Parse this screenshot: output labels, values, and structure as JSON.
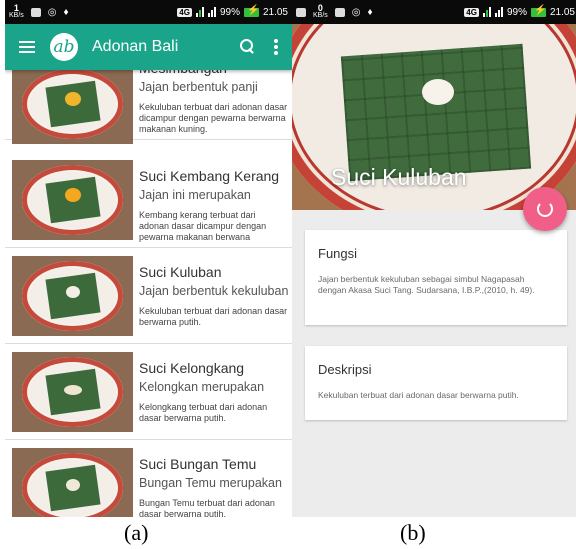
{
  "status_bar_a": {
    "kbs_value": "1",
    "kbs_unit": "KB/s",
    "network": "4G",
    "battery": "99%",
    "time": "21.05"
  },
  "status_bar_b": {
    "kbs_value": "0",
    "kbs_unit": "KB/s",
    "network": "4G",
    "battery": "99%",
    "time": "21.05"
  },
  "app_bar": {
    "title": "Adonan Bali",
    "logo_text": "ab",
    "icons": [
      "menu-icon",
      "search-icon",
      "more-vert-icon"
    ]
  },
  "list": {
    "items": [
      {
        "title": "Mesimbangan",
        "subtitle": "Jajan berbentuk panji",
        "description": "Kekuluban terbuat dari adonan dasar dicampur dengan pewarna berwarna makanan kuning.",
        "food_color": "#f1b52c"
      },
      {
        "title": "Suci Kembang Kerang",
        "subtitle": "Jajan ini merupakan",
        "description": "Kembang kerang terbuat dari adonan dasar dicampur dengan pewarna makanan berwana",
        "food_color": "#f3a820"
      },
      {
        "title": "Suci Kuluban",
        "subtitle": "Jajan berbentuk kekuluban",
        "description": "Kekuluban terbuat dari adonan dasar berwarna putih.",
        "food_color": "#f4efe4"
      },
      {
        "title": "Suci Kelongkang",
        "subtitle": "Kelongkan merupakan",
        "description": "Kelongkang terbuat dari adonan dasar berwarna putih.",
        "food_color": "#efe6d2"
      },
      {
        "title": "Suci Bungan Temu",
        "subtitle": "Bungan Temu merupakan",
        "description": "Bungan Temu terbuat dari adonan dasar berwarna putih.",
        "food_color": "#f0e9da"
      }
    ]
  },
  "detail": {
    "hero_title": "Suci Kuluban",
    "fab_icon": "refresh-icon",
    "cards": [
      {
        "title": "Fungsi",
        "body": "Jajan berbentuk kekuluban sebagai simbul Nagapasah dengan Akasa Suci Tang. Sudarsana, I.B.P.,(2010, h. 49)."
      },
      {
        "title": "Deskripsi",
        "body": "Kekuluban terbuat dari adonan dasar berwarna putih."
      }
    ]
  },
  "captions": {
    "a": "(a)",
    "b": "(b)"
  },
  "colors": {
    "app_bar": "#1aa58b",
    "fab": "#f15f89",
    "status_bar": "#0a0a0a"
  }
}
